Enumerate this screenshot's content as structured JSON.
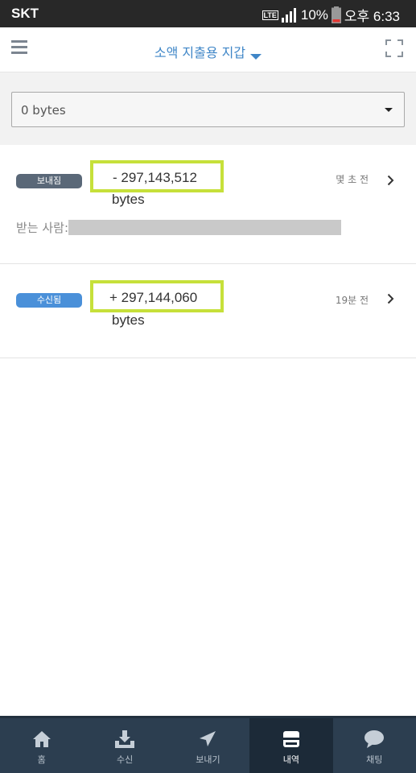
{
  "status_bar": {
    "carrier": "SKT",
    "network": "LTE",
    "battery": "10%",
    "time": "오후 6:33"
  },
  "header": {
    "wallet_name": "소액 지출용 지갑",
    "icons": [
      "menu-icon",
      "caret-down-icon",
      "scan-icon"
    ]
  },
  "filter": {
    "value": "0 bytes"
  },
  "transactions": [
    {
      "type": "보내짐",
      "amount": "- 297,143,512",
      "unit": "bytes",
      "time": "몇 초 전",
      "recipient_label": "받는 사람:"
    },
    {
      "type": "수신됨",
      "amount": "+ 297,144,060",
      "unit": "bytes",
      "time": "19분 전"
    }
  ],
  "nav": {
    "items": [
      {
        "label": "홈",
        "icon": "home-icon"
      },
      {
        "label": "수신",
        "icon": "receive-icon"
      },
      {
        "label": "보내기",
        "icon": "send-icon"
      },
      {
        "label": "내역",
        "icon": "history-icon",
        "active": true
      },
      {
        "label": "채팅",
        "icon": "chat-icon"
      }
    ]
  },
  "colors": {
    "accent": "#3f86c7",
    "highlight": "#c6e03a",
    "nav_bg": "#2c3e50",
    "sent_badge": "#5a6878",
    "received_badge": "#4a90d9"
  }
}
